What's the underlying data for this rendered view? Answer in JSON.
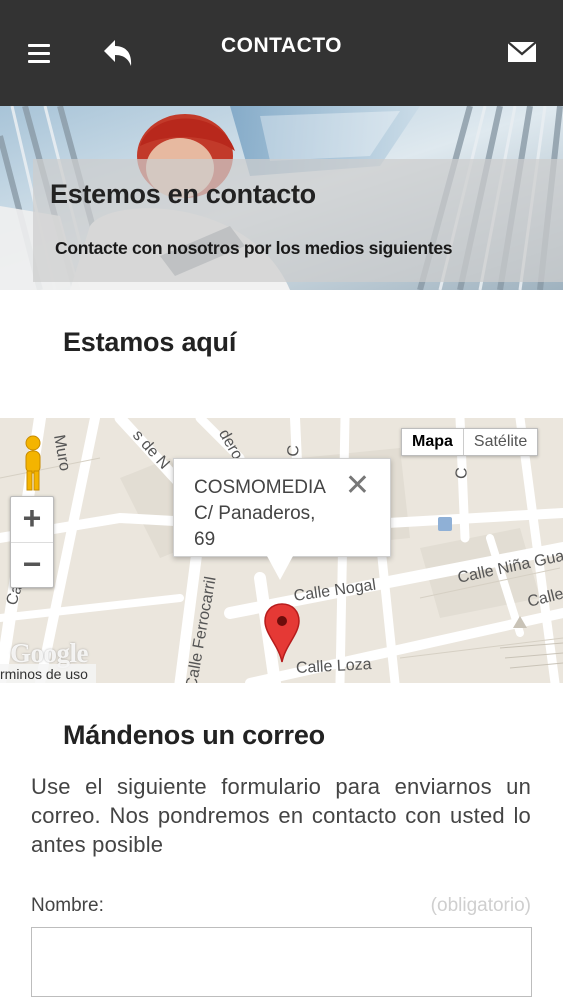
{
  "topbar": {
    "title": "CONTACTO",
    "icons": [
      "menu-icon",
      "back-icon",
      "mail-icon"
    ],
    "background": "#333333"
  },
  "hero": {
    "heading": "Estemos en contacto",
    "subheading": "Contacte con nosotros por los medios siguientes"
  },
  "location_section": {
    "heading": "Estamos aquí"
  },
  "map": {
    "map_type_map": "Mapa",
    "map_type_satellite": "Satélite",
    "zoom_in": "+",
    "zoom_out": "−",
    "info_window": {
      "line1": "COSMOMEDIA",
      "line2": "C/ Panaderos,",
      "line3": "69",
      "close": "✕"
    },
    "street_labels": [
      "Muro",
      "Calle Muro",
      "s de N",
      "deros",
      "lle C",
      "Calle Ferrocarril",
      "Calle Nogal",
      "Calle Loza",
      "Calle Niña Gua",
      "Calle",
      "C"
    ],
    "logo": "Google",
    "terms": "rminos de uso",
    "marker_color": "#e53935"
  },
  "mail_section": {
    "heading": "Mándenos un correo",
    "intro": "Use el siguiente formulario para enviarnos un correo. Nos pondremos en contacto con usted lo antes posible",
    "name_label": "Nombre:",
    "required_label": "(obligatorio)",
    "name_value": ""
  }
}
